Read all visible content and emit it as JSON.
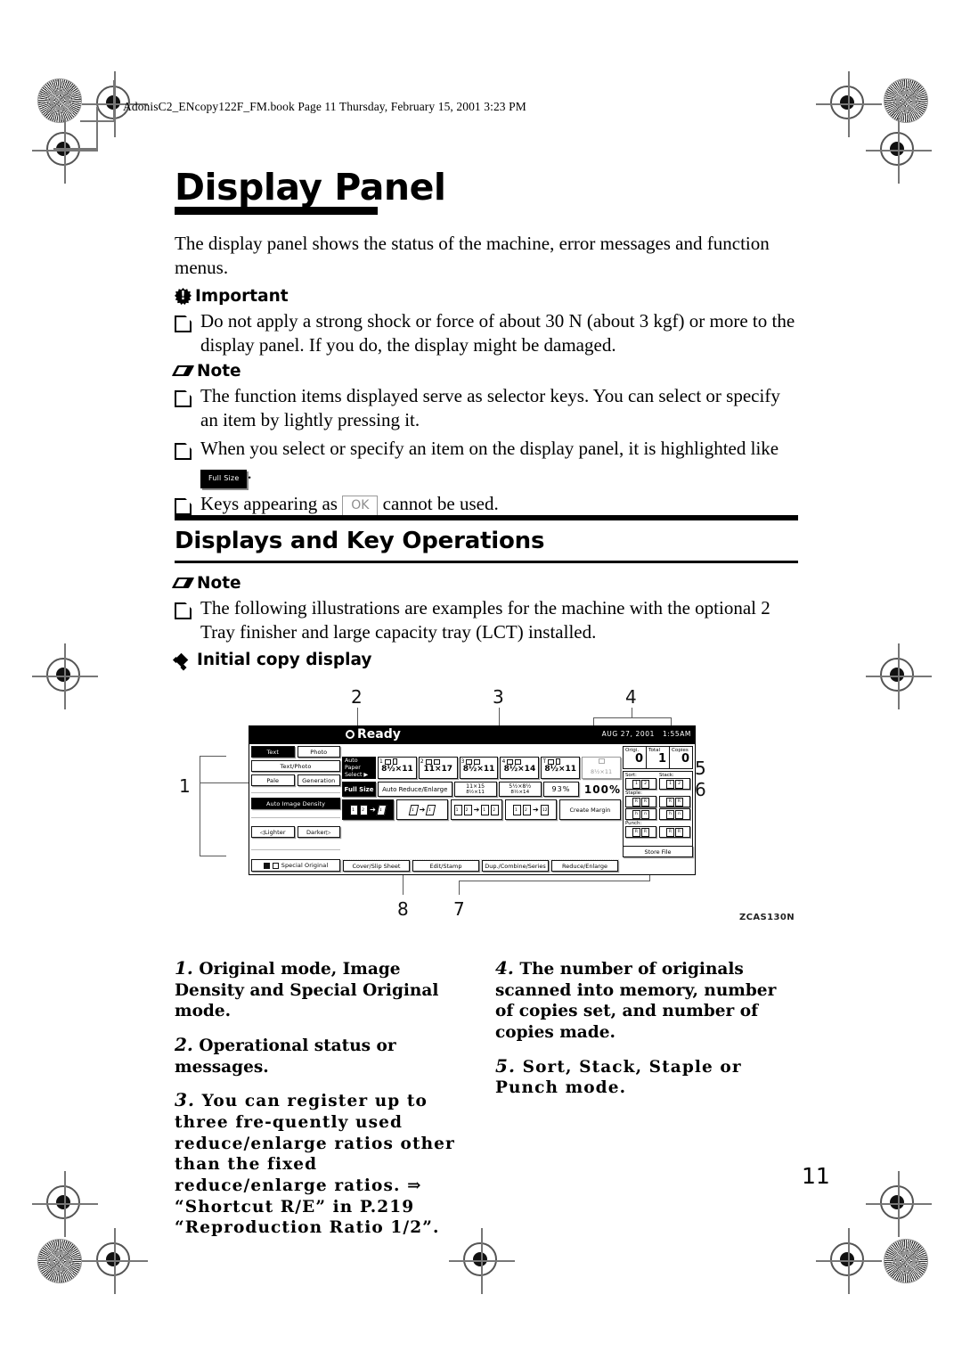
{
  "running_header": "AdonisC2_ENcopy122F_FM.book  Page 11  Thursday, February 15, 2001  3:23 PM",
  "page_number": "11",
  "title": "Display Panel",
  "intro": "The display panel shows the status of the machine, error messages and function menus.",
  "important": {
    "label": "Important",
    "icon": "important-burst-icon",
    "items": [
      "Do not apply a strong shock or force of about 30 N (about 3 kgf) or more to the display panel. If you do, the display might be damaged."
    ]
  },
  "note1": {
    "label": "Note",
    "icon": "pencil-note-icon",
    "item1": "The function items displayed serve as selector keys. You can select or specify an item by lightly pressing it.",
    "item2_pre": "When you select or specify an item on the display panel, it is highlighted like",
    "item2_key": "Full Size",
    "item2_post": ".",
    "item3_pre": "Keys appearing as",
    "item3_key": "OK",
    "item3_post": "cannot be used."
  },
  "section": {
    "heading": "Displays and Key Operations",
    "note_label": "Note",
    "note_item": "The following illustrations are examples for the machine with the optional 2 Tray finisher and large capacity tray (LCT) installed.",
    "subheading": "Initial copy display"
  },
  "figure": {
    "code": "ZCAS130N",
    "callouts": [
      "1",
      "2",
      "3",
      "4",
      "5",
      "6",
      "7",
      "8"
    ],
    "panel": {
      "status": "Ready",
      "date": "AUG  27, 2001",
      "time": "1:55AM",
      "left_buttons": [
        {
          "label": "Text",
          "selected": true
        },
        {
          "label": "Photo",
          "selected": false
        },
        {
          "label": "Text/Photo",
          "selected": false
        },
        {
          "label": "Pale",
          "selected": false
        },
        {
          "label": "Generation",
          "selected": false
        },
        {
          "label": "Auto Image Density",
          "selected": true
        },
        {
          "label": "Lighter",
          "selected": false
        },
        {
          "label": "Darker",
          "selected": false
        },
        {
          "label": "Special Original",
          "selected": false
        }
      ],
      "auto_paper_select": "Auto Paper Select",
      "trays": [
        {
          "id": "1",
          "size": "8½×11"
        },
        {
          "id": "2",
          "size": "11×17"
        },
        {
          "id": "3",
          "size": "8½×11"
        },
        {
          "id": "4",
          "size": "8½×14"
        },
        {
          "id": "T",
          "size": "8½×11"
        },
        {
          "id": "",
          "size": "8½×11"
        }
      ],
      "reduce_enlarge": {
        "full_size": "Full Size",
        "auto": "Auto Reduce/Enlarge",
        "shortcut1_num": "11×15",
        "shortcut1_den": "8½×11",
        "shortcut2_num": "5½×8½",
        "shortcut2_den": "8½×14",
        "shortcut3": "93%",
        "current": "100%"
      },
      "duplex": {
        "create_margin": "Create Margin"
      },
      "counters": [
        {
          "label": "Origi.",
          "value": "0"
        },
        {
          "label": "Total",
          "value": "1"
        },
        {
          "label": "Copies",
          "value": "0"
        }
      ],
      "finisher": {
        "sort": "Sort:",
        "stack": "Stack:",
        "staple": "Staple:",
        "punch": "Punch:"
      },
      "tabs": [
        "Cover/Slip Sheet",
        "Edit/Stamp",
        "Dup./Combine/Series",
        "Reduce/Enlarge"
      ],
      "store_file": "Store File"
    }
  },
  "descriptions": {
    "left": [
      {
        "num": "1.",
        "text": "Original mode, Image Density and Special Original mode."
      },
      {
        "num": "2.",
        "text": "Operational status or messages."
      },
      {
        "num": "3.",
        "text": "You can register up to three fre-quently used reduce/enlarge ratios other than the fixed reduce/enlarge ratios. ⇒ “Shortcut R/E” in P.219 “Reproduction Ratio 1/2”."
      }
    ],
    "right": [
      {
        "num": "4.",
        "text": "The number of originals scanned into memory, number of copies set, and number of copies made."
      },
      {
        "num": "5.",
        "text": "Sort, Stack, Staple or Punch mode."
      }
    ]
  }
}
